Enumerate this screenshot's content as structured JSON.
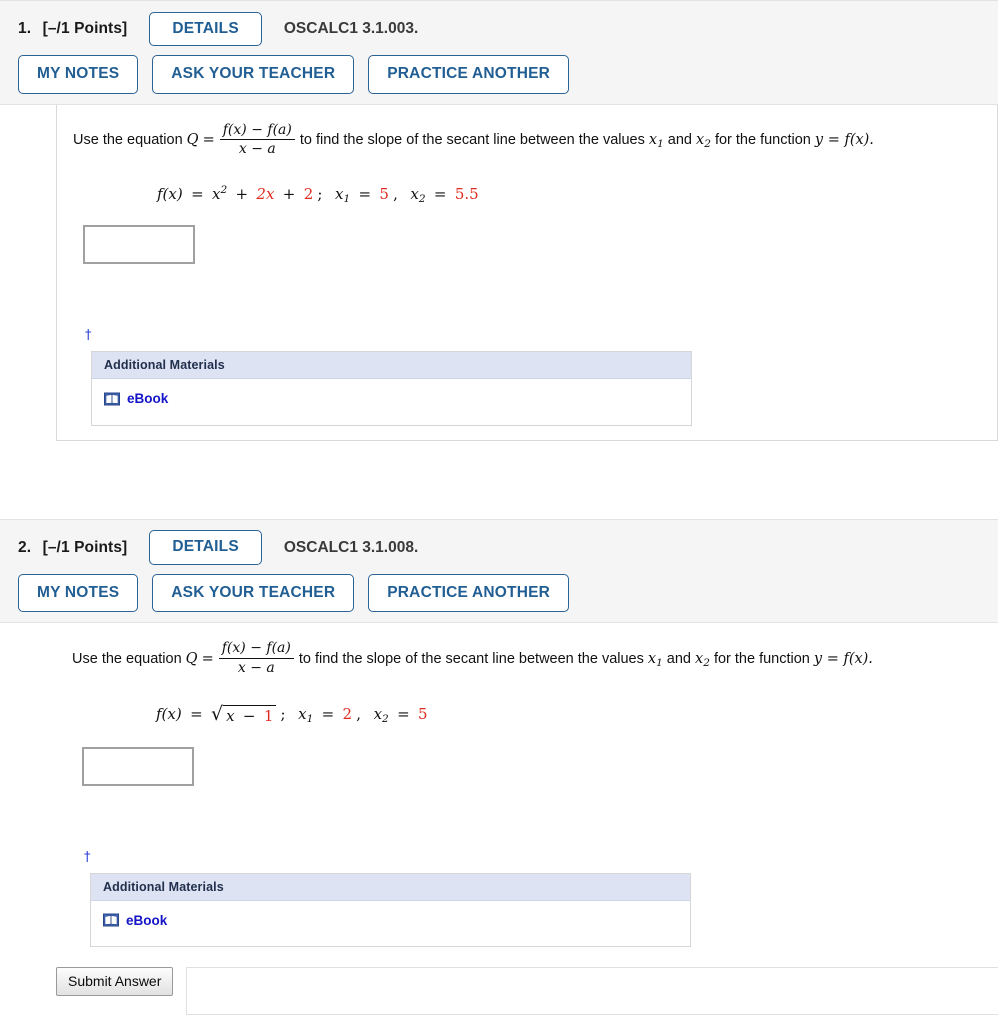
{
  "colors": {
    "button_border": "#2c6395",
    "button_text": "#215e93",
    "highlight_red": "#e02b20",
    "link_blue": "#1414c8",
    "dagger_blue": "#2f43d6",
    "panel_header_bg": "#dde3f2",
    "header_bg": "#f5f5f5"
  },
  "stem": {
    "lead": "Use the equation",
    "q_symbol": "Q",
    "equals": "=",
    "fraction_numerator": "f(x) − f(a)",
    "fraction_denominator": "x − a",
    "tail_1": "to find the slope of the secant line between the values",
    "var_x1": "x",
    "var_x1_sub": "1",
    "and": "and",
    "var_x2": "x",
    "var_x2_sub": "2",
    "tail_2": "for the function",
    "y_equals_fx": "y = f(x)."
  },
  "additional_materials": {
    "header": "Additional Materials",
    "items": [
      {
        "label": "eBook",
        "icon": "book-icon"
      }
    ]
  },
  "dagger_symbol": "†",
  "problems": [
    {
      "number": "1.",
      "points": "[–/1 Points]",
      "details_label": "DETAILS",
      "code": "OSCALC1 3.1.003.",
      "actions": [
        "MY NOTES",
        "ASK YOUR TEACHER",
        "PRACTICE ANOTHER"
      ],
      "function": {
        "type": "polynomial",
        "lhs": "f(x)",
        "equals": "=",
        "base": "x",
        "exponent": "2",
        "plus1": "+",
        "term1": "2x",
        "plus2": "+",
        "term2": "2",
        "semicolon": ";",
        "x1_label": "x",
        "x1_sub": "1",
        "x1_value": "5",
        "comma": ",",
        "x2_label": "x",
        "x2_sub": "2",
        "x2_value": "5.5"
      },
      "answer_value": "",
      "answer_placeholder": ""
    },
    {
      "number": "2.",
      "points": "[–/1 Points]",
      "details_label": "DETAILS",
      "code": "OSCALC1 3.1.008.",
      "actions": [
        "MY NOTES",
        "ASK YOUR TEACHER",
        "PRACTICE ANOTHER"
      ],
      "function": {
        "type": "sqrt",
        "lhs": "f(x)",
        "equals": "=",
        "radical": "√",
        "radicand_var": "x",
        "radicand_op": "−",
        "radicand_num": "1",
        "semicolon": ";",
        "x1_label": "x",
        "x1_sub": "1",
        "x1_value": "2",
        "comma": ",",
        "x2_label": "x",
        "x2_sub": "2",
        "x2_value": "5"
      },
      "answer_value": "",
      "answer_placeholder": ""
    }
  ],
  "submit": {
    "label": "Submit Answer"
  }
}
